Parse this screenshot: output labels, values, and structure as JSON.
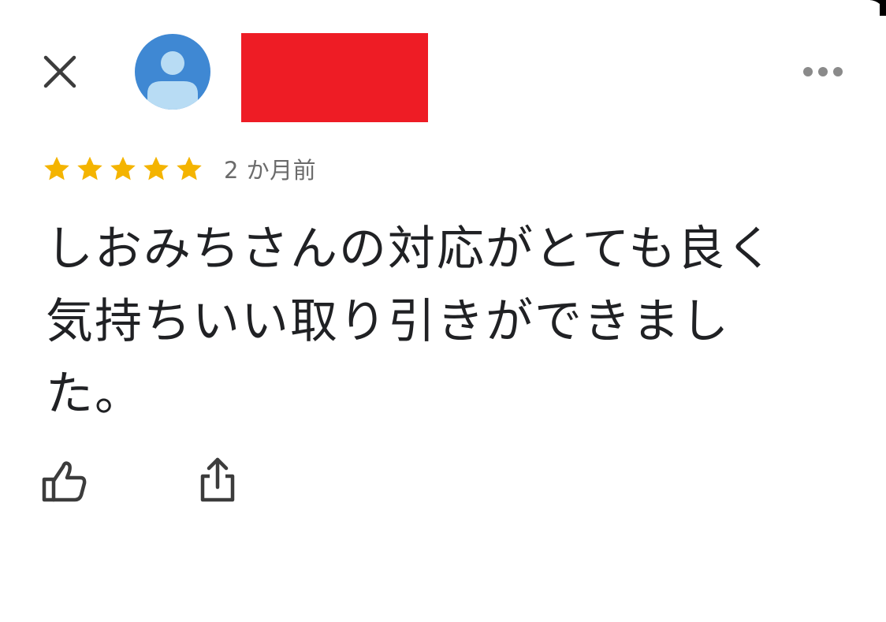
{
  "header": {
    "close_icon": "close-icon",
    "avatar_icon": "person-avatar-icon",
    "reviewer_name": "",
    "more_icon": "more-horizontal-icon"
  },
  "review": {
    "rating": 5,
    "rating_max": 5,
    "time_ago": "2 か月前",
    "text": "しおみちさんの対応がとても良く気持ちいい取り引きができました。"
  },
  "actions": {
    "like_icon": "thumbs-up-icon",
    "share_icon": "share-icon"
  },
  "colors": {
    "star": "#f4b400",
    "avatar_bg": "#3f88d3",
    "avatar_fg": "#b8dcf4",
    "redaction": "#ee1c25",
    "text": "#202124",
    "secondary_text": "#6b6b6b",
    "icon": "#3c3c3c"
  }
}
